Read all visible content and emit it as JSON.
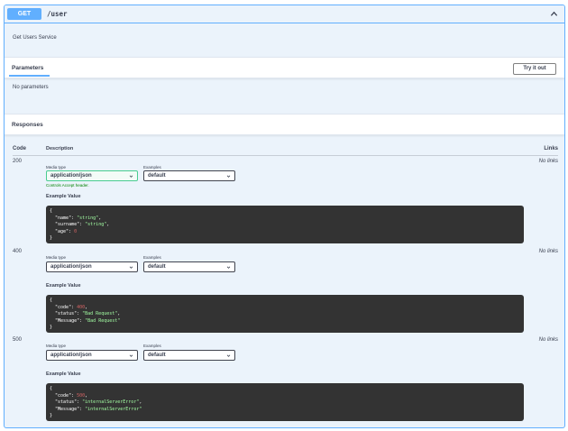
{
  "operation": {
    "method": "GET",
    "path": "/user",
    "description": "Get Users Service"
  },
  "parameters": {
    "tab_label": "Parameters",
    "try_button": "Try it out",
    "empty_text": "No parameters"
  },
  "responses": {
    "title": "Responses",
    "columns": {
      "code": "Code",
      "description": "Description",
      "links": "Links"
    },
    "media_type_label": "Media type",
    "examples_label": "Examples",
    "example_value_label": "Example Value",
    "accept_note": "Controls Accept header.",
    "rows": [
      {
        "code": "200",
        "links": "No links",
        "media_type": "application/json",
        "example": "default",
        "body": [
          [
            "{",
            null,
            null
          ],
          [
            "  \"name\": ",
            "\"string\"",
            ","
          ],
          [
            "  \"surname\": ",
            "\"string\"",
            ","
          ],
          [
            "  \"age\": ",
            "0",
            ""
          ],
          [
            "}",
            null,
            null
          ]
        ]
      },
      {
        "code": "400",
        "links": "No links",
        "media_type": "application/json",
        "example": "default",
        "body": [
          [
            "{",
            null,
            null
          ],
          [
            "  \"code\": ",
            "400",
            ","
          ],
          [
            "  \"status\": ",
            "\"Bad Request\"",
            ","
          ],
          [
            "  \"Message\": ",
            "\"Bad Request\"",
            ""
          ],
          [
            "}",
            null,
            null
          ]
        ]
      },
      {
        "code": "500",
        "links": "No links",
        "media_type": "application/json",
        "example": "default",
        "body": [
          [
            "{",
            null,
            null
          ],
          [
            "  \"code\": ",
            "500",
            ","
          ],
          [
            "  \"status\": ",
            "\"internalServerError\"",
            ","
          ],
          [
            "  \"Message\": ",
            "\"internalServerError\"",
            ""
          ],
          [
            "}",
            null,
            null
          ]
        ]
      }
    ]
  },
  "colors": {
    "get_accent": "#61affe",
    "panel_bg": "#ebf3fb",
    "code_bg": "#333333",
    "string_value": "#a2fca2",
    "number_value": "#d36363",
    "accept_note": "#008000"
  },
  "icons": {
    "collapse": "chevron-up-icon",
    "select": "chevron-down-icon"
  }
}
